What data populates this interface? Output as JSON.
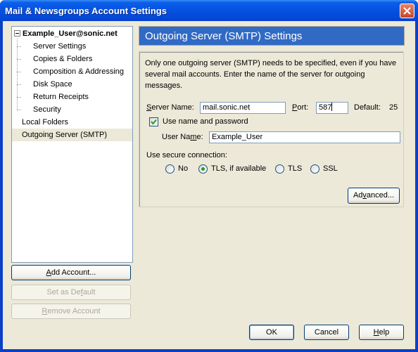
{
  "window": {
    "title": "Mail & Newsgroups Account Settings",
    "close_icon": "close-icon"
  },
  "tree": {
    "account": "Example_User@sonic.net",
    "account_children": [
      "Server Settings",
      "Copies & Folders",
      "Composition & Addressing",
      "Disk Space",
      "Return Receipts",
      "Security"
    ],
    "local_folders": "Local Folders",
    "outgoing_server": "Outgoing Server (SMTP)",
    "selected": "Outgoing Server (SMTP)"
  },
  "left_buttons": {
    "add_account": {
      "pre": "",
      "key": "A",
      "post": "dd Account..."
    },
    "set_default": {
      "pre": "Set as De",
      "key": "f",
      "post": "ault"
    },
    "remove_account": {
      "pre": "",
      "key": "R",
      "post": "emove Account"
    }
  },
  "panel": {
    "header": "Outgoing Server (SMTP) Settings",
    "description": "Only one outgoing server (SMTP) needs to be specified, even if you have several mail accounts. Enter the name of the server for outgoing messages.",
    "server_name_label": {
      "key": "S",
      "rest": "erver Name:"
    },
    "server_name_value": "mail.sonic.net",
    "port_label": {
      "key": "P",
      "rest": "ort:"
    },
    "port_value": "587",
    "default_label": "Default:",
    "default_value": "25",
    "use_auth_label": "Use name and password",
    "use_auth_checked": true,
    "user_name_label": {
      "pre": "User Na",
      "key": "m",
      "post": "e:"
    },
    "user_name_value": "Example_User",
    "secure_label": "Use secure connection:",
    "secure_options": [
      "No",
      "TLS, if available",
      "TLS",
      "SSL"
    ],
    "secure_selected": "TLS, if available",
    "advanced_button": {
      "pre": "Ad",
      "key": "v",
      "post": "anced..."
    }
  },
  "footer": {
    "ok": "OK",
    "cancel": "Cancel",
    "help": {
      "key": "H",
      "rest": "elp"
    }
  }
}
